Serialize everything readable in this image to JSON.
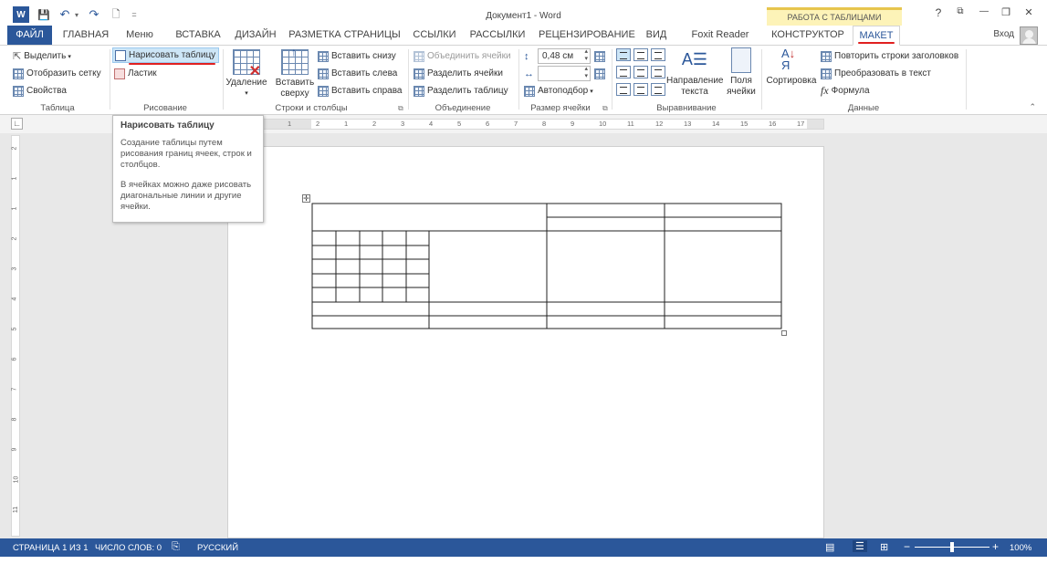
{
  "window": {
    "title": "Документ1 - Word",
    "context_group": "РАБОТА С ТАБЛИЦАМИ",
    "login": "Вход",
    "buttons": {
      "help": "?",
      "ribbon_options": "⧉",
      "minimize": "—",
      "restore": "❐",
      "close": "✕"
    }
  },
  "qat": {
    "word_icon": "W",
    "save_icon": "💾",
    "undo_icon": "↶",
    "redo_icon": "↷",
    "new_icon": "🗋",
    "customize": "="
  },
  "tabs": {
    "file": "ФАЙЛ",
    "home": "ГЛАВНАЯ",
    "menu": "Меню",
    "insert": "ВСТАВКА",
    "design": "ДИЗАЙН",
    "page_layout": "РАЗМЕТКА СТРАНИЦЫ",
    "references": "ССЫЛКИ",
    "mailings": "РАССЫЛКИ",
    "review": "РЕЦЕНЗИРОВАНИЕ",
    "view": "ВИД",
    "foxit": "Foxit Reader PDF",
    "constructor": "КОНСТРУКТОР",
    "layout": "МАКЕТ"
  },
  "ribbon": {
    "table": {
      "label": "Таблица",
      "select": "Выделить",
      "show_grid": "Отобразить сетку",
      "properties": "Свойства"
    },
    "draw": {
      "label": "Рисование",
      "draw_table": "Нарисовать таблицу",
      "eraser": "Ластик"
    },
    "rows_cols": {
      "label": "Строки и столбцы",
      "delete": "Удаление",
      "insert_above_1": "Вставить",
      "insert_above_2": "сверху",
      "insert_below": "Вставить снизу",
      "insert_left": "Вставить слева",
      "insert_right": "Вставить справа"
    },
    "merge": {
      "label": "Объединение",
      "merge_cells": "Объединить ячейки",
      "split_cells": "Разделить ячейки",
      "split_table": "Разделить таблицу"
    },
    "cell_size": {
      "label": "Размер ячейки",
      "height_value": "0,48 см",
      "width_value": "",
      "autofit": "Автоподбор"
    },
    "alignment": {
      "label": "Выравнивание",
      "text_direction_1": "Направление",
      "text_direction_2": "текста",
      "cell_margins_1": "Поля",
      "cell_margins_2": "ячейки"
    },
    "data": {
      "label": "Данные",
      "sort": "Сортировка",
      "repeat_header": "Повторить строки заголовков",
      "convert_to_text": "Преобразовать в текст",
      "formula": "Формула",
      "fx": "fx"
    }
  },
  "tooltip": {
    "title": "Нарисовать таблицу",
    "text1": "Создание таблицы путем рисования границ ячеек, строк и столбцов.",
    "text2": "В ячейках можно даже рисовать диагональные линии и другие ячейки."
  },
  "ruler": {
    "h_ticks": [
      "1",
      "2",
      "1",
      "2",
      "3",
      "4",
      "5",
      "6",
      "7",
      "8",
      "9",
      "10",
      "11",
      "12",
      "13",
      "14",
      "15",
      "16",
      "17"
    ],
    "v_ticks": [
      "2",
      "1",
      "1",
      "2",
      "3",
      "4",
      "5",
      "6",
      "7",
      "8",
      "9",
      "10",
      "11"
    ]
  },
  "statusbar": {
    "page": "СТРАНИЦА 1 ИЗ 1",
    "words": "ЧИСЛО СЛОВ: 0",
    "language": "РУССКИЙ",
    "zoom": "100%",
    "zoom_minus": "−",
    "zoom_plus": "+",
    "zoom_level": 0.5
  },
  "colors": {
    "accent": "#2b579a",
    "highlight": "#cde6f7",
    "underline": "#e02020",
    "context_tab": "#fdf3b8"
  }
}
